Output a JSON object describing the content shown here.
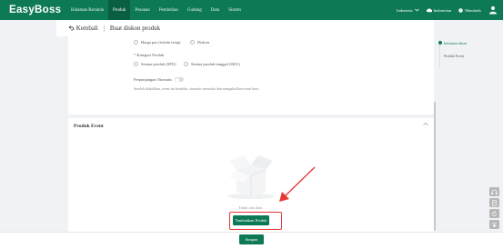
{
  "brand": {
    "logo": "EasyBoss",
    "nav_color": "#0e7a55",
    "accent": "#0e7a55",
    "highlight_color": "#e53935"
  },
  "nav": {
    "items": [
      "Halaman Beranda",
      "Produk",
      "Pesanan",
      "Pembelian",
      "Gudang",
      "Data",
      "Sistem"
    ],
    "active": "Produk",
    "language": "Indonesia",
    "org": "Indonesian",
    "help": "Manduels",
    "icons": {
      "language": "chevron-down-icon",
      "org": "cloud-icon",
      "help": "help-circle-icon",
      "user": "user-icon"
    }
  },
  "subbar": {
    "back_label": "Kembali",
    "title": "Buat diskon produk",
    "back_icon": "back-arrow-icon"
  },
  "form": {
    "price_option_1": "Harga pas (terlalu tetap)",
    "price_option_2": "Diskon",
    "category_label": "Kategori Produk",
    "category_required_mark": "*",
    "category_option_1": "Semua produk (SPU)",
    "category_option_2": "Semua produk tunggal (SKU)",
    "auto_extend_label": "Perpanjangan Otomatis",
    "auto_extend_on": false,
    "auto_extend_hint": "Setelah diaktifkan, event ini berakhir, otomatis memulai dan mengaktifkan event baru"
  },
  "product_event": {
    "title": "Produk Event",
    "collapse_icon": "chevron-up-icon",
    "empty_text": "Tidak ada data",
    "empty_icon": "empty-box-icon",
    "add_button": "Tambahkan Produk"
  },
  "footer": {
    "save_button": "Simpan"
  },
  "anchor": {
    "items": [
      "Informasi dasar",
      "Produk Event"
    ],
    "active_index": 0
  },
  "side_tools": [
    "headset-icon",
    "document-icon",
    "refresh-icon",
    "arrow-up-icon"
  ]
}
